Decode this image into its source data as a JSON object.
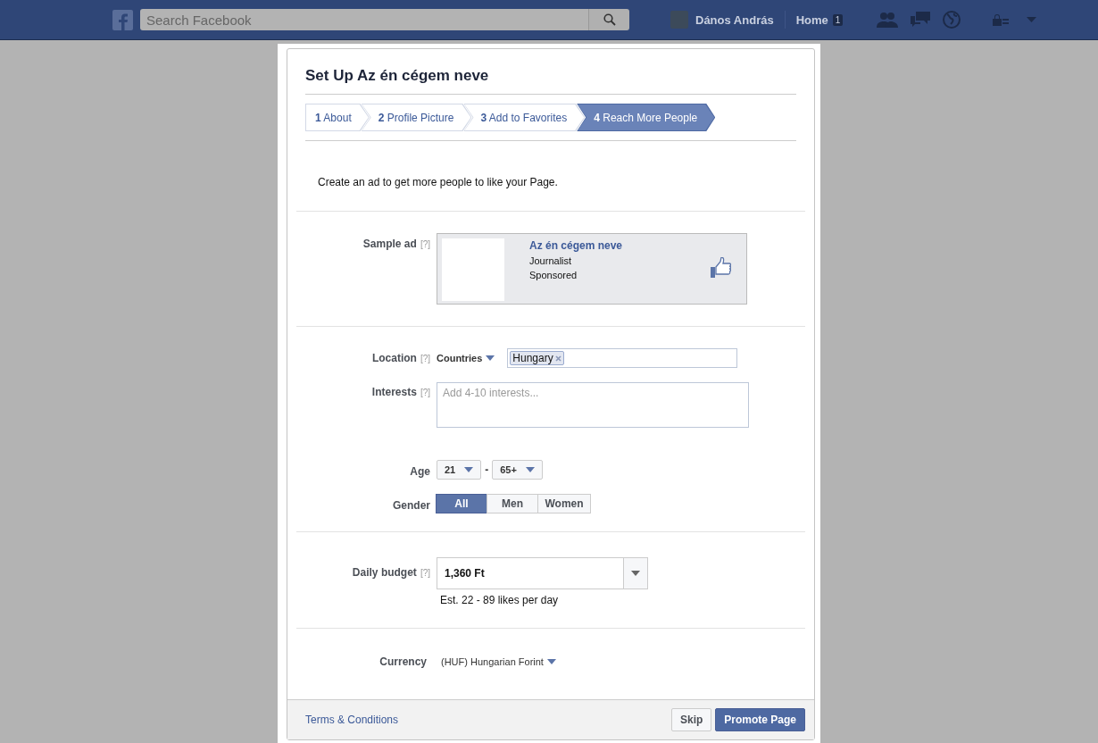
{
  "topbar": {
    "search": {
      "placeholder": "Search Facebook"
    },
    "user": "Dános András",
    "home": {
      "label": "Home",
      "badge": "1"
    }
  },
  "dialog": {
    "title": "Set Up Az én cégem neve",
    "steps": [
      {
        "number": "1",
        "label": "About",
        "selected": false
      },
      {
        "number": "2",
        "label": "Profile Picture",
        "selected": false
      },
      {
        "number": "3",
        "label": "Add to Favorites",
        "selected": false
      },
      {
        "number": "4",
        "label": "Reach More People",
        "selected": true
      }
    ],
    "intro": "Create an ad to get more people to like your Page.",
    "sample_ad": {
      "label": "Sample ad",
      "help": "[?]",
      "name": "Az én cégem neve",
      "category": "Journalist",
      "sponsored": "Sponsored"
    },
    "location": {
      "label": "Location",
      "help": "[?]",
      "mode": "Countries",
      "tags": [
        "Hungary"
      ]
    },
    "interests": {
      "label": "Interests",
      "help": "[?]",
      "placeholder": "Add 4-10 interests..."
    },
    "age": {
      "label": "Age",
      "min": "21",
      "separator": "-",
      "max": "65+"
    },
    "gender": {
      "label": "Gender",
      "options": [
        {
          "label": "All",
          "selected": true
        },
        {
          "label": "Men",
          "selected": false
        },
        {
          "label": "Women",
          "selected": false
        }
      ]
    },
    "budget": {
      "label": "Daily budget",
      "help": "[?]",
      "value": "1,360 Ft",
      "estimate": "Est. 22 - 89 likes per day"
    },
    "currency": {
      "label": "Currency",
      "value": "(HUF) Hungarian Forint"
    },
    "footer": {
      "terms": "Terms & Conditions",
      "buttons": [
        {
          "label": "Skip",
          "kind": "secondary"
        },
        {
          "label": "Promote Page",
          "kind": "primary"
        }
      ]
    }
  }
}
